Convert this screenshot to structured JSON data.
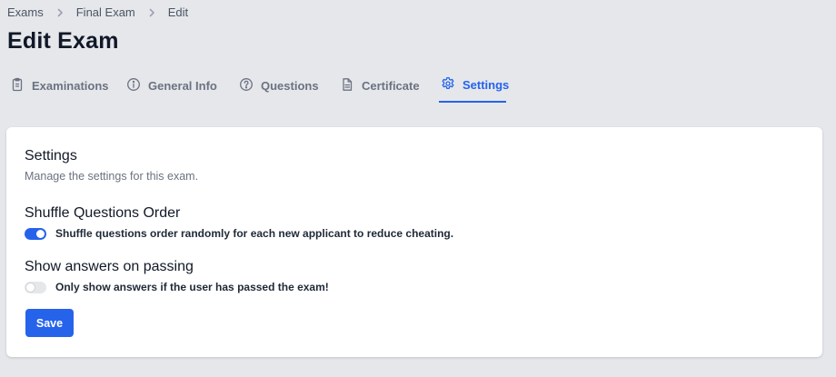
{
  "breadcrumb": {
    "items": [
      "Exams",
      "Final Exam",
      "Edit"
    ]
  },
  "page": {
    "title": "Edit Exam"
  },
  "tabs": [
    {
      "label": "Examinations",
      "icon": "clipboard-icon",
      "active": false
    },
    {
      "label": "General Info",
      "icon": "info-icon",
      "active": false
    },
    {
      "label": "Questions",
      "icon": "question-icon",
      "active": false
    },
    {
      "label": "Certificate",
      "icon": "document-icon",
      "active": false
    },
    {
      "label": "Settings",
      "icon": "gear-icon",
      "active": true
    }
  ],
  "settings": {
    "title": "Settings",
    "description": "Manage the settings for this exam.",
    "shuffle": {
      "title": "Shuffle Questions Order",
      "description": "Shuffle questions order randomly for each new applicant to reduce cheating.",
      "enabled": true
    },
    "show_answers": {
      "title": "Show answers on passing",
      "description": "Only show answers if the user has passed the exam!",
      "enabled": false
    },
    "save_label": "Save"
  },
  "colors": {
    "accent": "#2563eb",
    "background": "#e5e7eb",
    "card": "#ffffff"
  }
}
